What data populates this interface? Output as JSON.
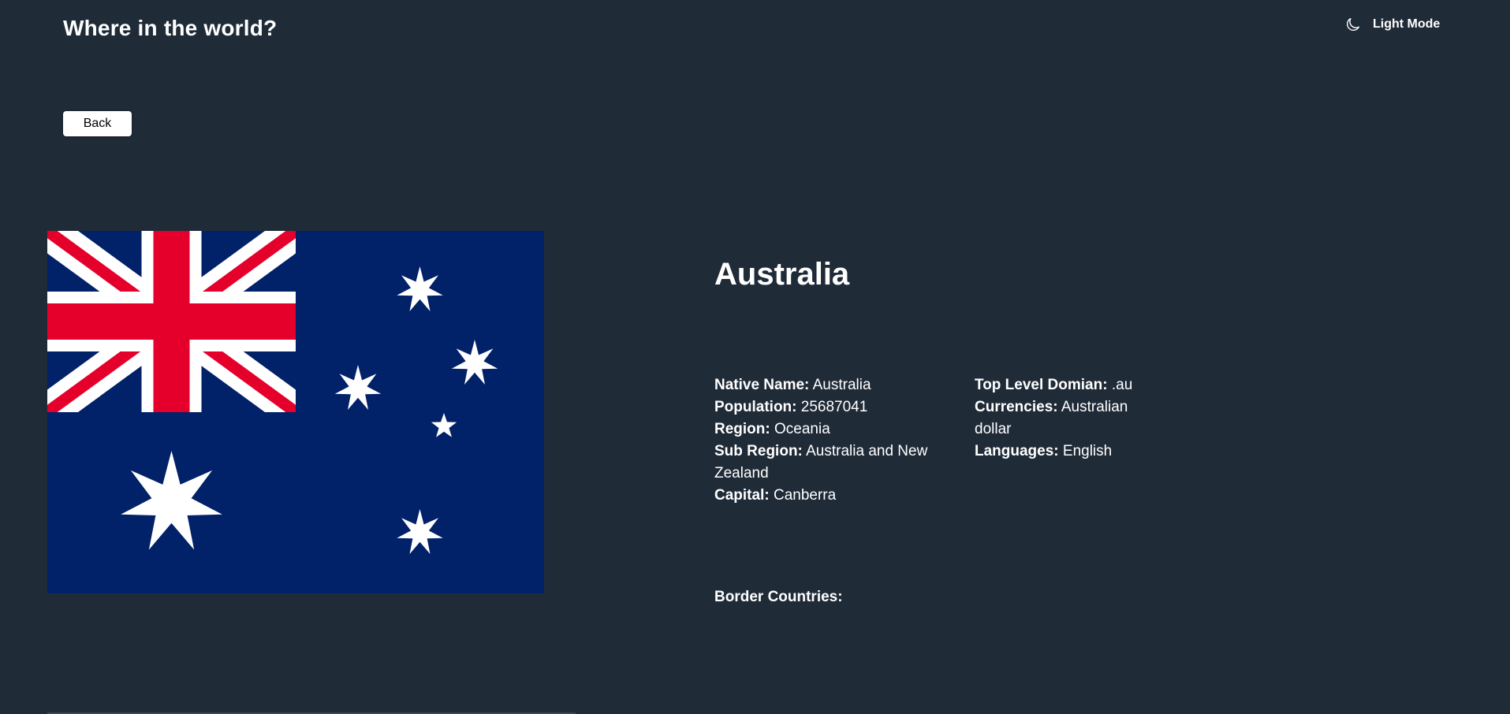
{
  "header": {
    "title": "Where in the world?",
    "theme_toggle": {
      "label": "Light Mode",
      "icon": "moon-icon"
    }
  },
  "back_button": {
    "label": "Back"
  },
  "country": {
    "name": "Australia",
    "flag_icon": "australia-flag",
    "details_left": [
      {
        "label": "Native Name:",
        "value": "Australia"
      },
      {
        "label": "Population:",
        "value": "25687041"
      },
      {
        "label": "Region:",
        "value": "Oceania"
      },
      {
        "label": "Sub Region:",
        "value": "Australia and New Zealand"
      },
      {
        "label": "Capital:",
        "value": "Canberra"
      }
    ],
    "details_right": [
      {
        "label": "Top Level Domian:",
        "value": ".au"
      },
      {
        "label": "Currencies:",
        "value": "Australian dollar"
      },
      {
        "label": "Languages:",
        "value": "English"
      }
    ],
    "border_countries_label": "Border Countries:"
  },
  "colors": {
    "background": "#202b38",
    "flag_blue": "#012169",
    "flag_red": "#e4002b",
    "text": "#ffffff"
  }
}
